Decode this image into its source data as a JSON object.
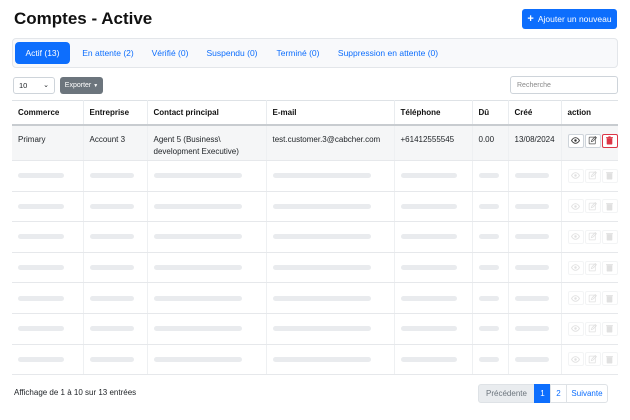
{
  "header": {
    "title": "Comptes - Active",
    "add_label": "Ajouter un nouveau"
  },
  "tabs": [
    {
      "label": "Actif (13)"
    },
    {
      "label": "En attente (2)"
    },
    {
      "label": "Vérifié (0)"
    },
    {
      "label": "Suspendu (0)"
    },
    {
      "label": "Terminé (0)"
    },
    {
      "label": "Suppression en attente (0)"
    }
  ],
  "toolbar": {
    "page_size": "10",
    "export_label": "Exporter",
    "search_placeholder": "Recherche"
  },
  "table": {
    "columns": [
      "Commerce",
      "Entreprise",
      "Contact principal",
      "E-mail",
      "Téléphone",
      "Dû",
      "Créé",
      "action"
    ],
    "rows": [
      {
        "commerce": "Primary",
        "entreprise": "Account 3",
        "contact_line1": "Agent 5 (Business\\",
        "contact_line2": "development Executive)",
        "email": "test.customer.3@cabcher.com",
        "phone": "+61412555545",
        "due": "0.00",
        "created": "13/08/2024"
      }
    ]
  },
  "footer": {
    "info": "Affichage de 1 à 10 sur 13 entrées",
    "prev": "Précédente",
    "page1": "1",
    "page2": "2",
    "next": "Suivante"
  },
  "colors": {
    "primary": "#0d6efd",
    "danger": "#dc3545",
    "secondary": "#6c757d"
  }
}
